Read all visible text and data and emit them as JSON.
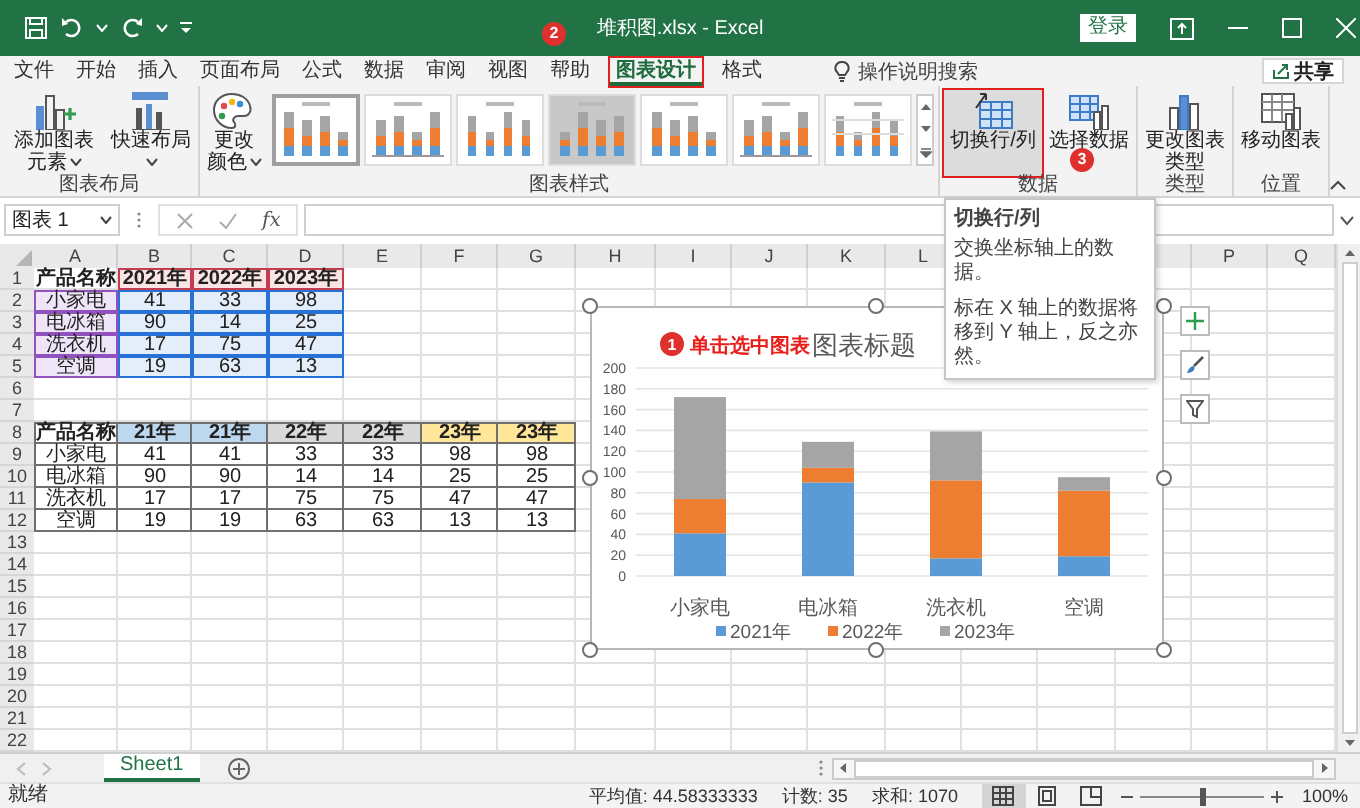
{
  "window": {
    "title": "堆积图.xlsx - Excel"
  },
  "signin_button": "登录",
  "ribbon_tabs": [
    {
      "label": "文件",
      "selected": false,
      "outlined": false
    },
    {
      "label": "开始",
      "selected": false,
      "outlined": false
    },
    {
      "label": "插入",
      "selected": false,
      "outlined": false
    },
    {
      "label": "页面布局",
      "selected": false,
      "outlined": false
    },
    {
      "label": "公式",
      "selected": false,
      "outlined": false
    },
    {
      "label": "数据",
      "selected": false,
      "outlined": false
    },
    {
      "label": "审阅",
      "selected": false,
      "outlined": false
    },
    {
      "label": "视图",
      "selected": false,
      "outlined": false
    },
    {
      "label": "帮助",
      "selected": false,
      "outlined": false
    },
    {
      "label": "图表设计",
      "selected": true,
      "outlined": true
    },
    {
      "label": "格式",
      "selected": false,
      "outlined": false
    }
  ],
  "tell_me": "操作说明搜索",
  "share_button": "共享",
  "ribbon_groups": [
    {
      "label": "图表布局",
      "commands": [
        {
          "kind": "add-element",
          "label": "添加图表元素",
          "dropdown": true,
          "hovered": false,
          "outlined": false
        },
        {
          "kind": "quick-layout",
          "label": "快速布局",
          "dropdown": true,
          "hovered": false,
          "outlined": false
        }
      ]
    },
    {
      "label": "图表样式",
      "commands": [
        {
          "kind": "change-colors",
          "label": "更改颜色",
          "dropdown": true,
          "hovered": false,
          "outlined": false
        }
      ],
      "gallery": [
        {
          "selected": true
        },
        {
          "selected": false
        },
        {
          "selected": false
        },
        {
          "selected": false
        },
        {
          "selected": false
        },
        {
          "selected": false
        },
        {
          "selected": false
        }
      ]
    },
    {
      "label": "数据",
      "commands": [
        {
          "kind": "switch-row-column",
          "label": "切换行/列",
          "dropdown": false,
          "hovered": true,
          "outlined": true
        },
        {
          "kind": "select-data",
          "label": "选择数据",
          "dropdown": false,
          "hovered": false,
          "outlined": false
        }
      ]
    },
    {
      "label": "类型",
      "commands": [
        {
          "kind": "change-type",
          "label": "更改图表类型",
          "dropdown": false,
          "hovered": false,
          "outlined": false
        }
      ]
    },
    {
      "label": "位置",
      "commands": [
        {
          "kind": "move-chart",
          "label": "移动图表",
          "dropdown": false,
          "hovered": false,
          "outlined": false
        }
      ]
    }
  ],
  "formula_bar": {
    "name_box": "图表 1",
    "fx_label": "fx"
  },
  "sheet": {
    "columns_left": [
      "A",
      "B",
      "C",
      "D",
      "E",
      "F",
      "G",
      "H",
      "I",
      "J",
      "K",
      "L"
    ],
    "columns_right": [
      "P",
      "Q"
    ],
    "rows": [
      {
        "number": "1",
        "bold": true,
        "bordered": false,
        "cells": [
          {
            "text": "产品名称"
          },
          {
            "text": "2021年",
            "range": true,
            "color": "#fbe4e4"
          },
          {
            "text": "2022年",
            "range": true,
            "color": "#fbe4e4"
          },
          {
            "text": "2023年",
            "range": true,
            "color": "#fbe4e4"
          }
        ]
      },
      {
        "number": "2",
        "bold": false,
        "bordered": false,
        "cells": [
          {
            "text": "小家电",
            "range": true,
            "color": "#efe5f8"
          },
          {
            "text": "41",
            "range": true,
            "color": "#e4edfa"
          },
          {
            "text": "33",
            "range": true,
            "color": "#e4edfa"
          },
          {
            "text": "98",
            "range": true,
            "color": "#e4edfa"
          }
        ]
      },
      {
        "number": "3",
        "bold": false,
        "bordered": false,
        "cells": [
          {
            "text": "电冰箱",
            "range": true,
            "color": "#efe5f8"
          },
          {
            "text": "90",
            "range": true,
            "color": "#e4edfa"
          },
          {
            "text": "14",
            "range": true,
            "color": "#e4edfa"
          },
          {
            "text": "25",
            "range": true,
            "color": "#e4edfa"
          }
        ]
      },
      {
        "number": "4",
        "bold": false,
        "bordered": false,
        "cells": [
          {
            "text": "洗衣机",
            "range": true,
            "color": "#efe5f8"
          },
          {
            "text": "17",
            "range": true,
            "color": "#e4edfa"
          },
          {
            "text": "75",
            "range": true,
            "color": "#e4edfa"
          },
          {
            "text": "47",
            "range": true,
            "color": "#e4edfa"
          }
        ]
      },
      {
        "number": "5",
        "bold": false,
        "bordered": false,
        "cells": [
          {
            "text": "空调",
            "range": true,
            "color": "#efe5f8"
          },
          {
            "text": "19",
            "range": true,
            "color": "#e4edfa"
          },
          {
            "text": "63",
            "range": true,
            "color": "#e4edfa"
          },
          {
            "text": "13",
            "range": true,
            "color": "#e4edfa"
          }
        ]
      },
      {
        "number": "6"
      },
      {
        "number": "7"
      },
      {
        "number": "8",
        "bold": true,
        "bordered": true,
        "cells": [
          {
            "text": "产品名称"
          },
          {
            "text": "21年",
            "color": "#bdd7ee"
          },
          {
            "text": "21年",
            "color": "#bdd7ee"
          },
          {
            "text": "22年",
            "color": "#d9d9d9"
          },
          {
            "text": "22年",
            "color": "#d9d9d9"
          },
          {
            "text": "23年",
            "color": "#ffe699"
          },
          {
            "text": "23年",
            "color": "#ffe699"
          }
        ]
      },
      {
        "number": "9",
        "bold": false,
        "bordered": true,
        "cells": [
          {
            "text": "小家电"
          },
          {
            "text": "41"
          },
          {
            "text": "41"
          },
          {
            "text": "33"
          },
          {
            "text": "33"
          },
          {
            "text": "98"
          },
          {
            "text": "98"
          }
        ]
      },
      {
        "number": "10",
        "bold": false,
        "bordered": true,
        "cells": [
          {
            "text": "电冰箱"
          },
          {
            "text": "90"
          },
          {
            "text": "90"
          },
          {
            "text": "14"
          },
          {
            "text": "14"
          },
          {
            "text": "25"
          },
          {
            "text": "25"
          }
        ]
      },
      {
        "number": "11",
        "bold": false,
        "bordered": true,
        "cells": [
          {
            "text": "洗衣机"
          },
          {
            "text": "17"
          },
          {
            "text": "17"
          },
          {
            "text": "75"
          },
          {
            "text": "75"
          },
          {
            "text": "47"
          },
          {
            "text": "47"
          }
        ]
      },
      {
        "number": "12",
        "bold": false,
        "bordered": true,
        "cells": [
          {
            "text": "空调"
          },
          {
            "text": "19"
          },
          {
            "text": "19"
          },
          {
            "text": "63"
          },
          {
            "text": "63"
          },
          {
            "text": "13"
          },
          {
            "text": "13"
          }
        ]
      },
      {
        "number": "13"
      },
      {
        "number": "14"
      },
      {
        "number": "15"
      },
      {
        "number": "16"
      },
      {
        "number": "17"
      },
      {
        "number": "18"
      },
      {
        "number": "19"
      },
      {
        "number": "20"
      },
      {
        "number": "21"
      },
      {
        "number": "22"
      }
    ]
  },
  "chart": {
    "chart_data": {
      "type": "bar",
      "title": "图表标题",
      "stacked": true,
      "orientation": "vertical",
      "grid": true,
      "legend": "bottom",
      "categories": [
        "小家电",
        "电冰箱",
        "洗衣机",
        "空调"
      ],
      "series": [
        {
          "name": "2021年",
          "color": "#5b9bd5",
          "values": [
            41,
            90,
            17,
            19
          ]
        },
        {
          "name": "2022年",
          "color": "#ed7d31",
          "values": [
            33,
            14,
            75,
            63
          ]
        },
        {
          "name": "2023年",
          "color": "#a5a5a5",
          "values": [
            98,
            25,
            47,
            13
          ]
        }
      ],
      "ylim": [
        0,
        200
      ],
      "yticks": [
        0,
        20,
        40,
        60,
        80,
        100,
        120,
        140,
        160,
        180,
        200
      ]
    }
  },
  "callouts": [
    {
      "number": "1",
      "text": "单击选中图表"
    },
    {
      "number": "2"
    },
    {
      "number": "3"
    }
  ],
  "tooltip": {
    "title": "切换行/列",
    "lines": [
      "交换坐标轴上的数据。",
      "标在 X 轴上的数据将移到 Y 轴上，反之亦然。"
    ]
  },
  "sheet_tabs": [
    {
      "label": "Sheet1",
      "selected": true
    }
  ],
  "status_bar": {
    "mode": "就绪",
    "stats": [
      "平均值: 44.58333333",
      "计数: 35",
      "求和: 1070"
    ],
    "views": [
      {
        "selected": true
      },
      {
        "selected": false
      },
      {
        "selected": false
      }
    ],
    "zoom": {
      "level": 0.5,
      "reading": "100%"
    }
  }
}
